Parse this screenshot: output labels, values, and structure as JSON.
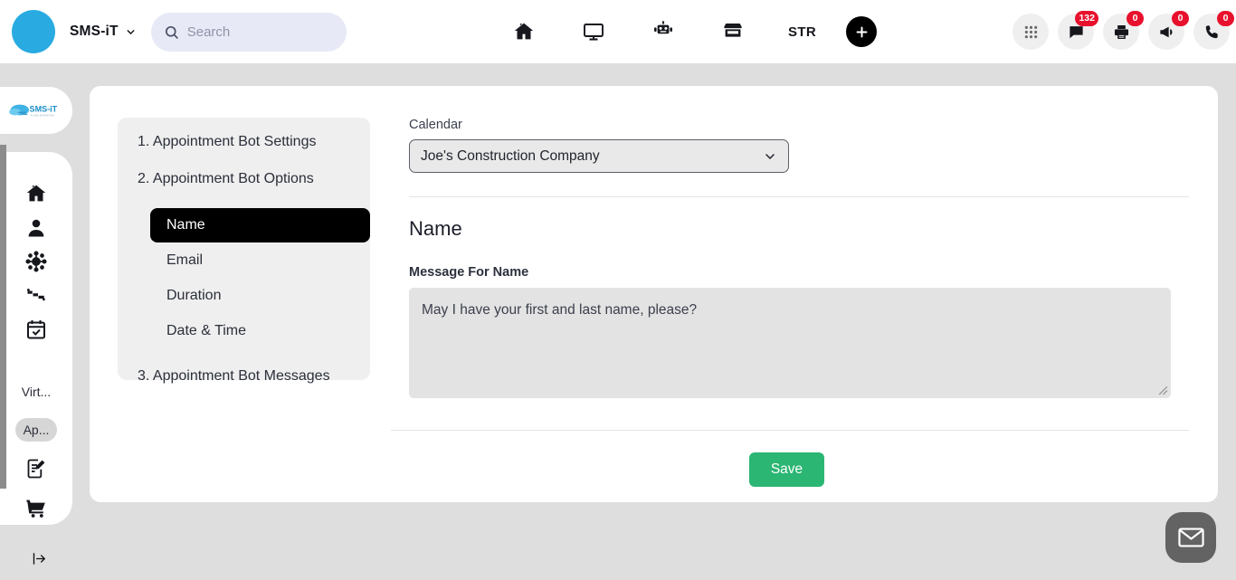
{
  "topbar": {
    "avatar": "user-avatar",
    "brand": "SMS-iT",
    "search_placeholder": "Search",
    "center_nav": [
      {
        "name": "home-icon",
        "label": ""
      },
      {
        "name": "monitor-icon",
        "label": ""
      },
      {
        "name": "robot-icon",
        "label": ""
      },
      {
        "name": "store-icon",
        "label": ""
      },
      {
        "name": "str-label",
        "label": "STR"
      }
    ],
    "add_button": "+",
    "right_nav": [
      {
        "name": "apps-grid-icon",
        "badge": null
      },
      {
        "name": "chat-icon",
        "badge": "132"
      },
      {
        "name": "printer-icon",
        "badge": "0"
      },
      {
        "name": "megaphone-icon",
        "badge": "0"
      },
      {
        "name": "phone-icon",
        "badge": "0"
      }
    ]
  },
  "sidebar": {
    "logo": "SMS-iT",
    "items": [
      {
        "name": "home-icon",
        "label": ""
      },
      {
        "name": "contacts-icon",
        "label": ""
      },
      {
        "name": "network-icon",
        "label": ""
      },
      {
        "name": "funnel-icon",
        "label": ""
      },
      {
        "name": "calendar-check-icon",
        "label": ""
      }
    ],
    "text_items": [
      {
        "label": "Virt...",
        "active": false
      },
      {
        "label": "Ap...",
        "active": true
      }
    ],
    "bottom_items": [
      {
        "name": "document-edit-icon",
        "label": ""
      },
      {
        "name": "cart-icon",
        "label": ""
      }
    ],
    "collapse": "expand-sidebar-icon"
  },
  "steps": {
    "step1": "1. Appointment Bot Settings",
    "step2": "2. Appointment Bot Options",
    "options": [
      {
        "label": "Name",
        "active": true
      },
      {
        "label": "Email",
        "active": false
      },
      {
        "label": "Duration",
        "active": false
      },
      {
        "label": "Date & Time",
        "active": false
      }
    ],
    "step3": "3. Appointment Bot Messages"
  },
  "form": {
    "calendar_label": "Calendar",
    "calendar_value": "Joe's Construction Company",
    "section_title": "Name",
    "message_label": "Message For Name",
    "message_value": "May I have your first and last name, please?",
    "save_label": "Save"
  },
  "fab": {
    "name": "mail-icon"
  },
  "colors": {
    "accent_blue": "#29abe2",
    "save_green": "#2bb673",
    "badge_red": "#e8112d",
    "page_bg": "#dedede",
    "active_black": "#000000"
  }
}
